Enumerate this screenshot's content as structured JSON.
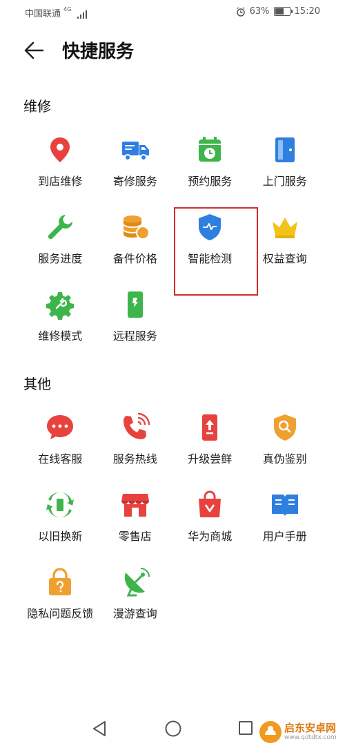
{
  "status_bar": {
    "carrier": "中国联通",
    "network": "4G",
    "battery": "63%",
    "time": "15:20"
  },
  "header": {
    "title": "快捷服务"
  },
  "sections": [
    {
      "title": "维修",
      "items": [
        {
          "label": "到店维修",
          "icon": "map-pin-icon",
          "color": "#e8423f"
        },
        {
          "label": "寄修服务",
          "icon": "truck-icon",
          "color": "#2f7fe0"
        },
        {
          "label": "预约服务",
          "icon": "calendar-clock-icon",
          "color": "#3db54a"
        },
        {
          "label": "上门服务",
          "icon": "door-icon",
          "color": "#2f7fe0"
        },
        {
          "label": "服务进度",
          "icon": "wrench-icon",
          "color": "#3db54a"
        },
        {
          "label": "备件价格",
          "icon": "coins-icon",
          "color": "#f0a030"
        },
        {
          "label": "智能检测",
          "icon": "shield-pulse-icon",
          "color": "#2f7fe0"
        },
        {
          "label": "权益查询",
          "icon": "crown-icon",
          "color": "#f2c318"
        },
        {
          "label": "维修模式",
          "icon": "gear-wrench-icon",
          "color": "#3db54a"
        },
        {
          "label": "远程服务",
          "icon": "phone-remote-icon",
          "color": "#3db54a"
        }
      ]
    },
    {
      "title": "其他",
      "items": [
        {
          "label": "在线客服",
          "icon": "chat-bubble-icon",
          "color": "#e8423f"
        },
        {
          "label": "服务热线",
          "icon": "phone-call-icon",
          "color": "#e8423f"
        },
        {
          "label": "升级尝鲜",
          "icon": "upgrade-phone-icon",
          "color": "#e8423f"
        },
        {
          "label": "真伪鉴别",
          "icon": "shield-search-icon",
          "color": "#f0a030"
        },
        {
          "label": "以旧换新",
          "icon": "trade-in-icon",
          "color": "#3db54a"
        },
        {
          "label": "零售店",
          "icon": "store-icon",
          "color": "#e8423f"
        },
        {
          "label": "华为商城",
          "icon": "shopping-bag-icon",
          "color": "#e8423f"
        },
        {
          "label": "用户手册",
          "icon": "book-icon",
          "color": "#2f7fe0"
        },
        {
          "label": "隐私问题反馈",
          "icon": "lock-question-icon",
          "color": "#f0a030"
        },
        {
          "label": "漫游查询",
          "icon": "satellite-dish-icon",
          "color": "#3db54a"
        }
      ]
    }
  ],
  "watermark": {
    "text": "启东安卓网",
    "url": "www.qdtdtx.com"
  }
}
